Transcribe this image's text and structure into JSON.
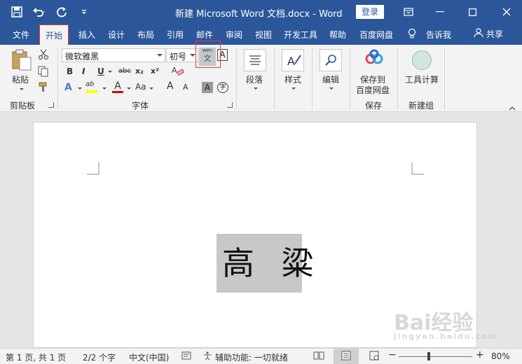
{
  "titlebar": {
    "doc_title": "新建 Microsoft Word 文档.docx  -  Word",
    "login_label": "登录"
  },
  "tabs": [
    {
      "label": "文件"
    },
    {
      "label": "开始"
    },
    {
      "label": "插入"
    },
    {
      "label": "设计"
    },
    {
      "label": "布局"
    },
    {
      "label": "引用"
    },
    {
      "label": "邮件"
    },
    {
      "label": "审阅"
    },
    {
      "label": "视图"
    },
    {
      "label": "开发工具"
    },
    {
      "label": "帮助"
    },
    {
      "label": "百度网盘"
    }
  ],
  "tell_me": "告诉我",
  "share": "共享",
  "ribbon": {
    "clipboard": {
      "paste_label": "粘贴",
      "group": "剪贴板"
    },
    "font": {
      "font_name": "微软雅黑",
      "font_size": "初号",
      "group": "字体",
      "bold": "B",
      "italic": "I",
      "underline": "U",
      "strike": "abc",
      "subscript": "x₂",
      "superscript": "x²",
      "phonetic_top": "wén",
      "phonetic_bottom": "文",
      "char_border": "A",
      "text_effect": "A",
      "highlight": "ab",
      "font_color": "A",
      "change_case": "Aa",
      "grow": "A",
      "shrink": "A",
      "shading": "A",
      "enclose": "字"
    },
    "paragraph": {
      "label": "段落"
    },
    "styles": {
      "label": "样式"
    },
    "editing": {
      "label": "编辑"
    },
    "baidu": {
      "label_line1": "保存到",
      "label_line2": "百度网盘",
      "group": "保存"
    },
    "newgroup": {
      "label": "工具计算",
      "group": "新建组"
    }
  },
  "document": {
    "text": "高 粱"
  },
  "statusbar": {
    "page": "第 1 页, 共 1 页",
    "words": "2/2 个字",
    "language": "中文(中国)",
    "accessibility": "辅助功能: 一切就绪",
    "zoom": "80%"
  },
  "watermark": {
    "text": "Bai经验",
    "sub": "jingyan.baidu.com"
  },
  "colors": {
    "brand": "#2b579a",
    "highlight_red": "#e53935"
  }
}
